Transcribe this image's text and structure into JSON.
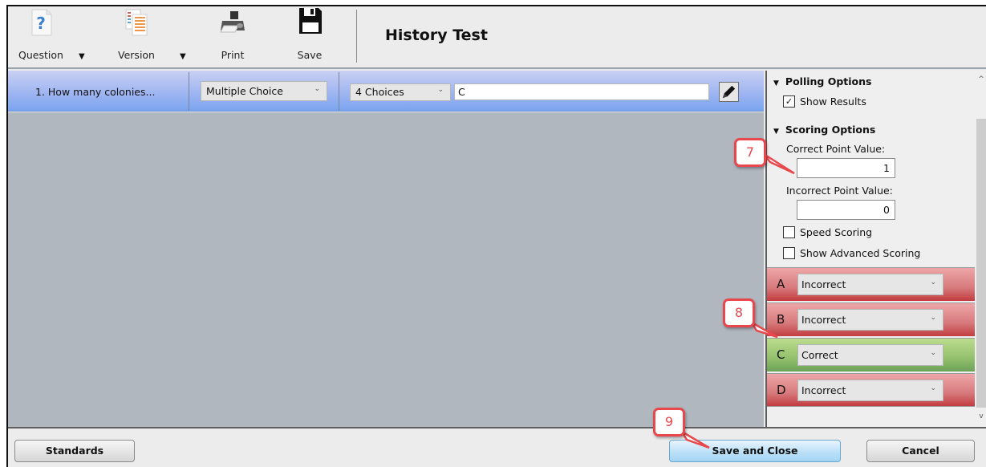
{
  "toolbar": {
    "question_label": "Question",
    "version_label": "Version",
    "print_label": "Print",
    "save_label": "Save",
    "dropdown_arrow": "▼",
    "title": "History Test"
  },
  "question_row": {
    "title": "1. How many colonies...",
    "type_select": "Multiple Choice",
    "choices_select": "4 Choices",
    "answer_value": "C",
    "chevron": "⌄"
  },
  "right_panel": {
    "polling": {
      "heading": "Polling Options",
      "show_results_label": "Show Results",
      "show_results_checked": true
    },
    "scoring": {
      "heading": "Scoring Options",
      "correct_label": "Correct Point Value:",
      "correct_value": "1",
      "incorrect_label": "Incorrect Point Value:",
      "incorrect_value": "0",
      "speed_scoring_label": "Speed Scoring",
      "speed_scoring_checked": false,
      "advanced_scoring_label": "Show Advanced Scoring",
      "advanced_scoring_checked": false
    },
    "choices": [
      {
        "letter": "A",
        "value": "Incorrect",
        "status": "incorrect"
      },
      {
        "letter": "B",
        "value": "Incorrect",
        "status": "incorrect"
      },
      {
        "letter": "C",
        "value": "Correct",
        "status": "correct"
      },
      {
        "letter": "D",
        "value": "Incorrect",
        "status": "incorrect"
      }
    ],
    "section_triangle": "▼",
    "check_mark": "✓"
  },
  "bottom_bar": {
    "standards_label": "Standards",
    "save_close_label": "Save and Close",
    "cancel_label": "Cancel"
  },
  "callouts": {
    "seven": "7",
    "eight": "8",
    "nine": "9"
  },
  "colors": {
    "incorrect": "#d77a7c",
    "correct": "#93c06d",
    "callout": "#e8474c",
    "question_row": "#9cb4f1"
  }
}
